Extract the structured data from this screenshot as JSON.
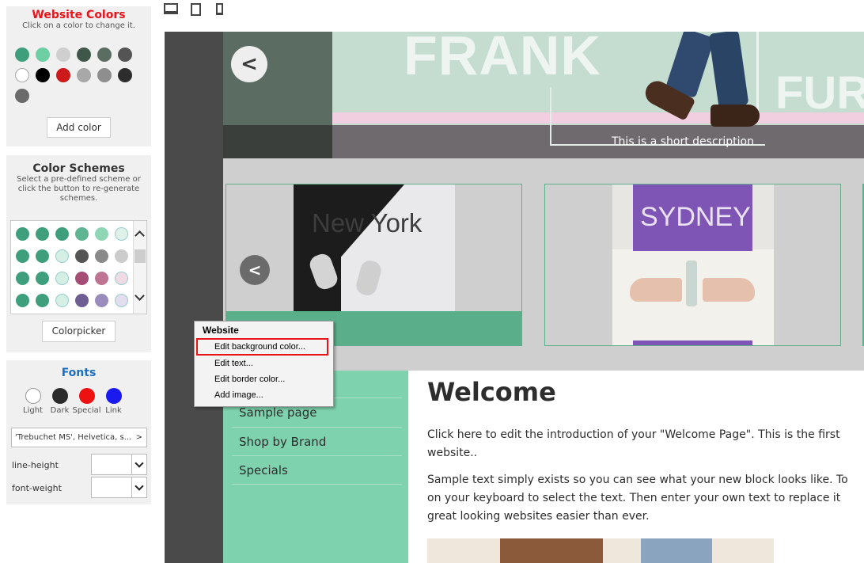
{
  "website_colors": {
    "title": "Website Colors",
    "subtitle": "Click on a color to change it.",
    "swatches": [
      "#3f9f7c",
      "#6fcfa4",
      "#cfcfcf",
      "#3f574a",
      "#5b6d62",
      "#545454",
      "#ffffff",
      "#000000",
      "#cc1a1a",
      "#a8a8a8",
      "#8e8e8e",
      "#2d2d2d",
      "#6b6b6b"
    ],
    "add_label": "Add color"
  },
  "color_schemes": {
    "title": "Color Schemes",
    "subtitle": "Select a pre-defined scheme or click the button to re-generate schemes.",
    "rows": [
      [
        "#3f9f7c",
        "#3f9f7c",
        "#3f9f7c",
        "#5fb592",
        "#8fd6b4",
        "#dff2ea"
      ],
      [
        "#3f9f7c",
        "#3f9f7c",
        "#d6efe4",
        "#555555",
        "#8a8a8a",
        "#cccccc"
      ],
      [
        "#3f9f7c",
        "#3f9f7c",
        "#d6efe4",
        "#a64d75",
        "#c07494",
        "#f0dbe4"
      ],
      [
        "#3f9f7c",
        "#3f9f7c",
        "#d6efe4",
        "#6e5e94",
        "#9a8cbd",
        "#e2def0"
      ]
    ],
    "scroll_up_icon": "chevron-up-icon",
    "scroll_down_icon": "chevron-down-icon",
    "button_label": "Colorpicker"
  },
  "fonts": {
    "title": "Fonts",
    "swatches": [
      {
        "label": "Light",
        "color": "#ffffff"
      },
      {
        "label": "Dark",
        "color": "#2b2b2b"
      },
      {
        "label": "Special",
        "color": "#ee1111"
      },
      {
        "label": "Link",
        "color": "#1a1aee"
      }
    ],
    "family_value": "'Trebuchet MS', Helvetica, s...",
    "family_arrow": ">",
    "line_height_label": "line-height",
    "font_weight_label": "font-weight",
    "dropdown_arrow": "v"
  },
  "toolbar": {
    "icons": [
      "desktop-icon",
      "tablet-icon",
      "mobile-icon"
    ]
  },
  "site": {
    "header_big_text": "FRANK",
    "header_second_text": "FUR",
    "header_description": "This is a short description",
    "header_prev_glyph": "<",
    "cards": [
      {
        "label": "New York"
      },
      {
        "label": "SYDNEY"
      }
    ],
    "carousel_prev_glyph": "<",
    "menu_items": [
      "Sample page",
      "Shop by Brand",
      "Specials"
    ],
    "welcome_title": "Welcome",
    "intro_text": "Click here to edit the introduction of your \"Welcome Page\". This is the first",
    "intro_text_2": "website..",
    "body_text_1": "Sample text simply exists so you can see what your new block looks like. To",
    "body_text_2": "on your keyboard to select the text. Then enter your own text to replace it",
    "body_text_3": "great looking websites easier than ever.",
    "colors": {
      "accent_green": "#7ed2ae",
      "header_mint": "#c4ddd0",
      "sydney_purple": "#7e55b4"
    }
  },
  "context_menu": {
    "title": "Website",
    "items": [
      "Edit background color...",
      "Edit text...",
      "Edit border color...",
      "Add image..."
    ],
    "highlight_color": "#e8141a"
  }
}
